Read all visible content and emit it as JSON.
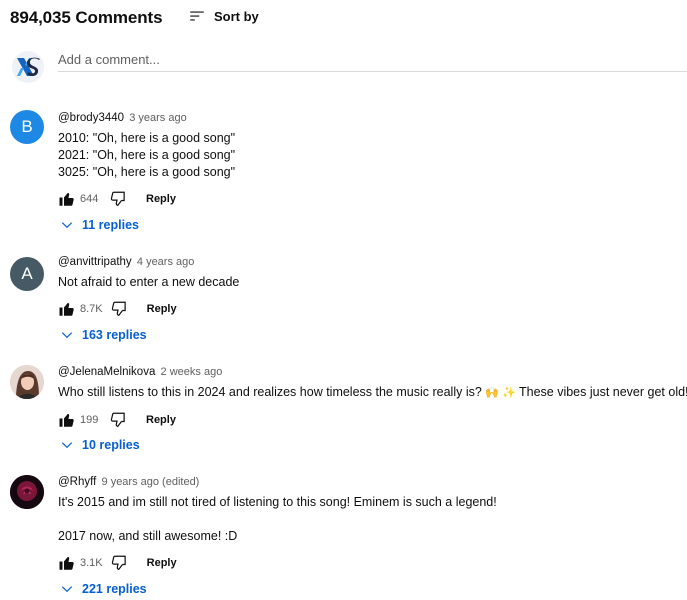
{
  "header": {
    "comment_count": "894,035 Comments",
    "sort_label": "Sort by",
    "sort_icon": "sort-icon"
  },
  "add_comment": {
    "placeholder": "Add a comment...",
    "avatar_icon": "xs-logo-avatar"
  },
  "comments": [
    {
      "avatar_letter": "B",
      "avatar_color": "#1e88e5",
      "handle": "@brody3440",
      "time": "3 years ago",
      "text": "2010: \"Oh, here is a good song\"\n2021: \"Oh, here is a good song\"\n3025: \"Oh, here is a good song\"",
      "likes": "644",
      "reply_label": "Reply",
      "replies_label": "11 replies"
    },
    {
      "avatar_letter": "A",
      "avatar_color": "#455a64",
      "handle": "@anvittripathy",
      "time": "4 years ago",
      "text": "Not afraid to enter a new decade",
      "likes": "8.7K",
      "reply_label": "Reply",
      "replies_label": "163 replies"
    },
    {
      "avatar_image": "portrait-photo",
      "handle": "@JelenaMelnikova",
      "time": "2 weeks ago",
      "text": "Who still listens to this in 2024 and realizes how timeless the music really is?",
      "text_emoji_1": "🙌 ✨",
      "text_tail": "These vibes just never get old!",
      "text_emoji_2": "🕊",
      "likes": "199",
      "reply_label": "Reply",
      "replies_label": "10 replies"
    },
    {
      "avatar_image": "rose-photo",
      "handle": "@Rhyff",
      "time": "9 years ago (edited)",
      "text": "It's 2015 and im still not tired of listening to this song! Eminem is such a legend!\n\n2017 now, and still awesome! :D",
      "likes": "3.1K",
      "reply_label": "Reply",
      "replies_label": "221 replies"
    }
  ],
  "colors": {
    "link_blue": "#065fd4",
    "secondary_text": "#606060",
    "primary_text": "#0f0f0f"
  }
}
